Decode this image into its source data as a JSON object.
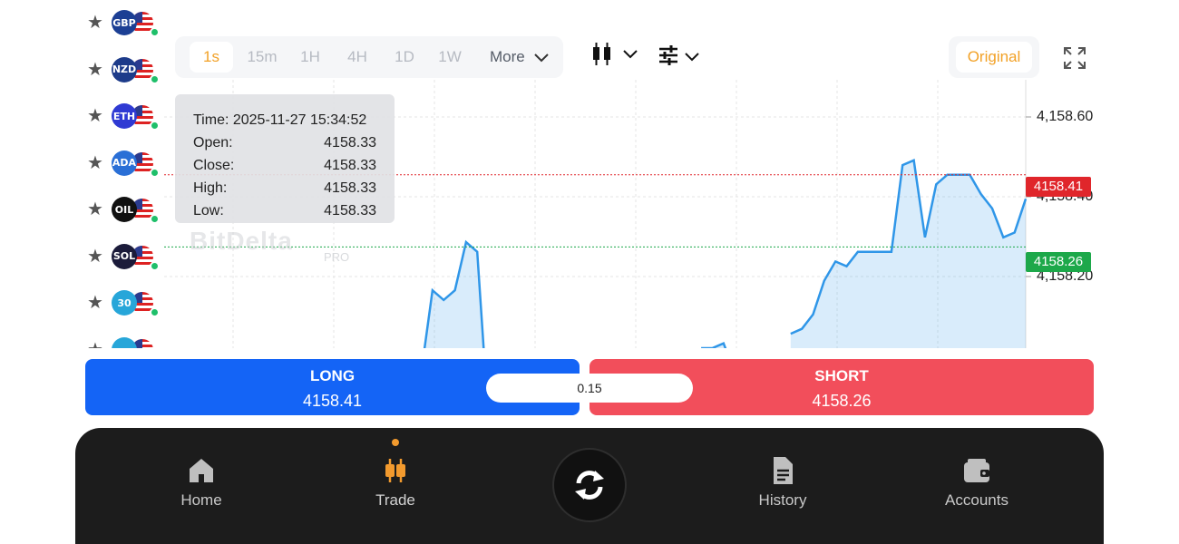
{
  "colors": {
    "accent": "#f2a126",
    "long": "#1464f6",
    "short": "#f24e5b",
    "ask_line": "#e0262b",
    "bid_line": "#1da84a",
    "line": "#2f96e8"
  },
  "favorites": [
    {
      "coin": "GBP",
      "coin_icon": "uk-flag-icon",
      "coin_color": "#1c3f94"
    },
    {
      "coin": "NZD",
      "coin_icon": "nz-flag-icon",
      "coin_color": "#1d3b8a"
    },
    {
      "coin": "ETH",
      "coin_icon": "ethereum-icon",
      "coin_color": "#2f3ad3"
    },
    {
      "coin": "ADA",
      "coin_icon": "cardano-icon",
      "coin_color": "#2a6fd6"
    },
    {
      "coin": "OIL",
      "coin_icon": "oil-drop-icon",
      "coin_color": "#111111"
    },
    {
      "coin": "SOL",
      "coin_icon": "solana-icon",
      "coin_color": "#1b1b3a"
    },
    {
      "coin": "30",
      "coin_icon": "index-30-icon",
      "coin_color": "#27a6d9"
    },
    {
      "coin": "",
      "coin_icon": "partial-coin-icon",
      "coin_color": "#27a6d9"
    }
  ],
  "toolbar": {
    "timeframes": [
      "1s",
      "15m",
      "1H",
      "4H",
      "1D",
      "1W"
    ],
    "active_timeframe": "1s",
    "more_label": "More",
    "original_label": "Original"
  },
  "tooltip": {
    "time_label": "Time:",
    "time_value": "2025-11-27 15:34:52",
    "rows": [
      {
        "label": "Open:",
        "value": "4158.33"
      },
      {
        "label": "Close:",
        "value": "4158.33"
      },
      {
        "label": "High:",
        "value": "4158.33"
      },
      {
        "label": "Low:",
        "value": "4158.33"
      }
    ]
  },
  "watermark": {
    "brand": "BitDelta",
    "sub": "PRO"
  },
  "axis": {
    "labels": [
      "4,158.60",
      "4,158.40",
      "4,158.20"
    ]
  },
  "price_tags": {
    "ask": "4158.41",
    "bid": "4158.26"
  },
  "chart_data": {
    "type": "area",
    "y_unit": "price",
    "ylim": [
      4158.05,
      4158.72
    ],
    "ask": 4158.41,
    "bid": 4158.26,
    "series": [
      {
        "values": [
          null,
          null,
          null,
          null,
          null,
          null,
          null,
          null,
          null,
          null,
          null,
          null,
          null,
          null,
          null,
          null,
          null,
          null,
          null,
          null,
          null,
          null,
          4158.0,
          4158.17,
          4158.15,
          4158.17,
          4158.27,
          4158.25,
          4157.9,
          null,
          null,
          null,
          null,
          null,
          null,
          null,
          null,
          null,
          null,
          null,
          null,
          null,
          null,
          null,
          null,
          null,
          null,
          4158.05,
          4158.05,
          4158.06,
          4158.0,
          null,
          null,
          null,
          null,
          4158.08,
          4158.09,
          4158.12,
          4158.19,
          4158.23,
          4158.22,
          4158.25,
          4158.25,
          4158.25,
          4158.25,
          4158.43,
          4158.44,
          4158.28,
          4158.39,
          4158.41,
          4158.41,
          4158.41,
          4158.37,
          4158.34,
          4158.28,
          4158.29,
          4158.36
        ]
      }
    ]
  },
  "trade": {
    "long_label": "LONG",
    "long_price": "4158.41",
    "short_label": "SHORT",
    "short_price": "4158.26",
    "spread": "0.15"
  },
  "nav": {
    "home": "Home",
    "trade": "Trade",
    "history": "History",
    "accounts": "Accounts"
  }
}
